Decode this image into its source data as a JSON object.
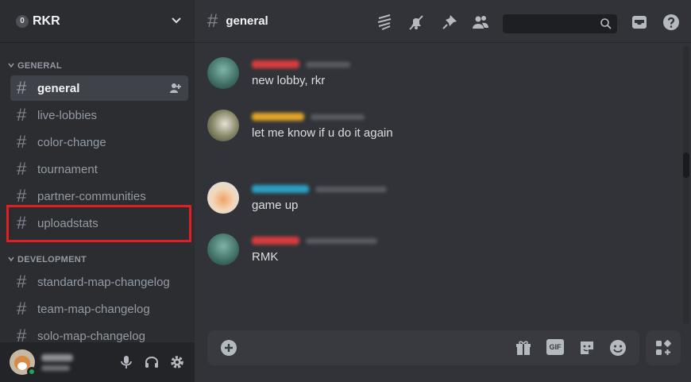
{
  "server": {
    "badge": "0",
    "name": "RKR"
  },
  "categories": [
    {
      "label": "GENERAL"
    },
    {
      "label": "DEVELOPMENT"
    }
  ],
  "channels": [
    {
      "name": "general",
      "active": true
    },
    {
      "name": "live-lobbies"
    },
    {
      "name": "color-change"
    },
    {
      "name": "tournament"
    },
    {
      "name": "partner-communities"
    },
    {
      "name": "uploadstats",
      "highlighted": true
    },
    {
      "name": "standard-map-changelog"
    },
    {
      "name": "team-map-changelog"
    },
    {
      "name": "solo-map-changelog"
    }
  ],
  "hash_glyph": "#",
  "topbar": {
    "channel_title": "general"
  },
  "messages": [
    {
      "text": "new lobby, rkr",
      "name_color": "#d83c3e"
    },
    {
      "text": "let me know if u do it again",
      "name_color": "#e0a526"
    },
    {
      "text": "game up",
      "name_color": "#2ba0c4"
    },
    {
      "text": "RMK",
      "name_color": "#d83c3e"
    }
  ],
  "composer": {
    "gif_label": "GIF"
  },
  "colors": {
    "accent_highlight": "#e01e24",
    "online": "#23a559",
    "sidebar_bg": "#2b2d31",
    "main_bg": "#313338"
  },
  "icons": [
    "chevron-down-icon",
    "add-member-icon",
    "threads-icon",
    "mute-icon",
    "pin-icon",
    "members-icon",
    "search-icon",
    "inbox-icon",
    "help-icon",
    "mic-icon",
    "headphones-icon",
    "gear-icon",
    "add-attachment-icon",
    "gift-icon",
    "gif-icon",
    "sticker-icon",
    "emoji-icon",
    "apps-icon"
  ]
}
